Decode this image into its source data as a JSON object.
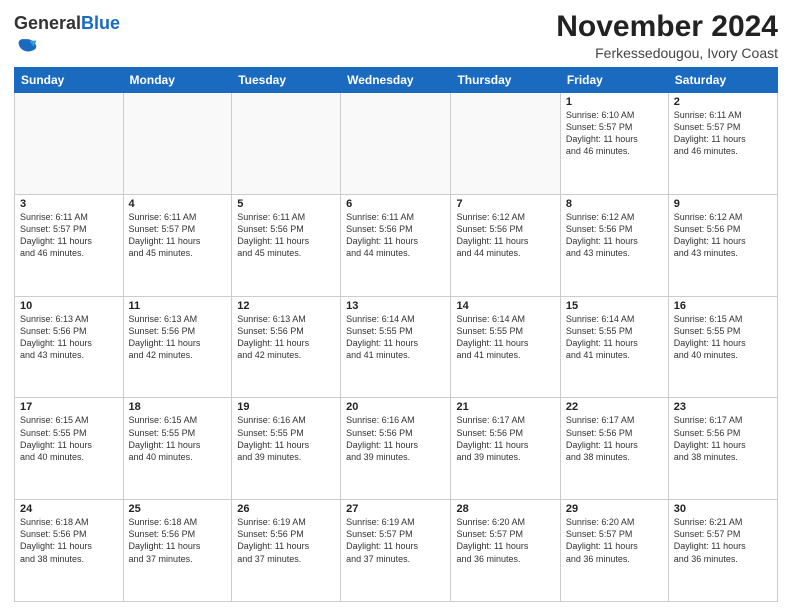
{
  "logo": {
    "general": "General",
    "blue": "Blue"
  },
  "header": {
    "month": "November 2024",
    "location": "Ferkessedougou, Ivory Coast"
  },
  "days_of_week": [
    "Sunday",
    "Monday",
    "Tuesday",
    "Wednesday",
    "Thursday",
    "Friday",
    "Saturday"
  ],
  "weeks": [
    [
      {
        "day": "",
        "info": ""
      },
      {
        "day": "",
        "info": ""
      },
      {
        "day": "",
        "info": ""
      },
      {
        "day": "",
        "info": ""
      },
      {
        "day": "",
        "info": ""
      },
      {
        "day": "1",
        "info": "Sunrise: 6:10 AM\nSunset: 5:57 PM\nDaylight: 11 hours\nand 46 minutes."
      },
      {
        "day": "2",
        "info": "Sunrise: 6:11 AM\nSunset: 5:57 PM\nDaylight: 11 hours\nand 46 minutes."
      }
    ],
    [
      {
        "day": "3",
        "info": "Sunrise: 6:11 AM\nSunset: 5:57 PM\nDaylight: 11 hours\nand 46 minutes."
      },
      {
        "day": "4",
        "info": "Sunrise: 6:11 AM\nSunset: 5:57 PM\nDaylight: 11 hours\nand 45 minutes."
      },
      {
        "day": "5",
        "info": "Sunrise: 6:11 AM\nSunset: 5:56 PM\nDaylight: 11 hours\nand 45 minutes."
      },
      {
        "day": "6",
        "info": "Sunrise: 6:11 AM\nSunset: 5:56 PM\nDaylight: 11 hours\nand 44 minutes."
      },
      {
        "day": "7",
        "info": "Sunrise: 6:12 AM\nSunset: 5:56 PM\nDaylight: 11 hours\nand 44 minutes."
      },
      {
        "day": "8",
        "info": "Sunrise: 6:12 AM\nSunset: 5:56 PM\nDaylight: 11 hours\nand 43 minutes."
      },
      {
        "day": "9",
        "info": "Sunrise: 6:12 AM\nSunset: 5:56 PM\nDaylight: 11 hours\nand 43 minutes."
      }
    ],
    [
      {
        "day": "10",
        "info": "Sunrise: 6:13 AM\nSunset: 5:56 PM\nDaylight: 11 hours\nand 43 minutes."
      },
      {
        "day": "11",
        "info": "Sunrise: 6:13 AM\nSunset: 5:56 PM\nDaylight: 11 hours\nand 42 minutes."
      },
      {
        "day": "12",
        "info": "Sunrise: 6:13 AM\nSunset: 5:56 PM\nDaylight: 11 hours\nand 42 minutes."
      },
      {
        "day": "13",
        "info": "Sunrise: 6:14 AM\nSunset: 5:55 PM\nDaylight: 11 hours\nand 41 minutes."
      },
      {
        "day": "14",
        "info": "Sunrise: 6:14 AM\nSunset: 5:55 PM\nDaylight: 11 hours\nand 41 minutes."
      },
      {
        "day": "15",
        "info": "Sunrise: 6:14 AM\nSunset: 5:55 PM\nDaylight: 11 hours\nand 41 minutes."
      },
      {
        "day": "16",
        "info": "Sunrise: 6:15 AM\nSunset: 5:55 PM\nDaylight: 11 hours\nand 40 minutes."
      }
    ],
    [
      {
        "day": "17",
        "info": "Sunrise: 6:15 AM\nSunset: 5:55 PM\nDaylight: 11 hours\nand 40 minutes."
      },
      {
        "day": "18",
        "info": "Sunrise: 6:15 AM\nSunset: 5:55 PM\nDaylight: 11 hours\nand 40 minutes."
      },
      {
        "day": "19",
        "info": "Sunrise: 6:16 AM\nSunset: 5:55 PM\nDaylight: 11 hours\nand 39 minutes."
      },
      {
        "day": "20",
        "info": "Sunrise: 6:16 AM\nSunset: 5:56 PM\nDaylight: 11 hours\nand 39 minutes."
      },
      {
        "day": "21",
        "info": "Sunrise: 6:17 AM\nSunset: 5:56 PM\nDaylight: 11 hours\nand 39 minutes."
      },
      {
        "day": "22",
        "info": "Sunrise: 6:17 AM\nSunset: 5:56 PM\nDaylight: 11 hours\nand 38 minutes."
      },
      {
        "day": "23",
        "info": "Sunrise: 6:17 AM\nSunset: 5:56 PM\nDaylight: 11 hours\nand 38 minutes."
      }
    ],
    [
      {
        "day": "24",
        "info": "Sunrise: 6:18 AM\nSunset: 5:56 PM\nDaylight: 11 hours\nand 38 minutes."
      },
      {
        "day": "25",
        "info": "Sunrise: 6:18 AM\nSunset: 5:56 PM\nDaylight: 11 hours\nand 37 minutes."
      },
      {
        "day": "26",
        "info": "Sunrise: 6:19 AM\nSunset: 5:56 PM\nDaylight: 11 hours\nand 37 minutes."
      },
      {
        "day": "27",
        "info": "Sunrise: 6:19 AM\nSunset: 5:57 PM\nDaylight: 11 hours\nand 37 minutes."
      },
      {
        "day": "28",
        "info": "Sunrise: 6:20 AM\nSunset: 5:57 PM\nDaylight: 11 hours\nand 36 minutes."
      },
      {
        "day": "29",
        "info": "Sunrise: 6:20 AM\nSunset: 5:57 PM\nDaylight: 11 hours\nand 36 minutes."
      },
      {
        "day": "30",
        "info": "Sunrise: 6:21 AM\nSunset: 5:57 PM\nDaylight: 11 hours\nand 36 minutes."
      }
    ]
  ]
}
